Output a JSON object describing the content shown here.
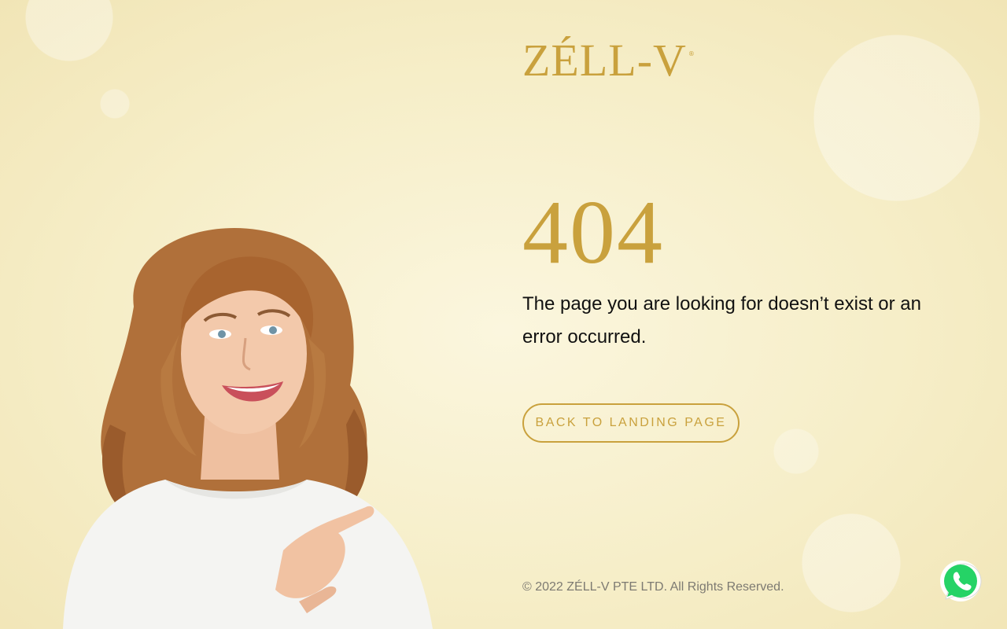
{
  "brand": {
    "logo_text": "ZÉLL-V",
    "logo_mark": "®",
    "accent_color": "#c9a13d"
  },
  "error": {
    "code": "404",
    "message": "The page you are looking for doesn’t exist or an error occurred."
  },
  "actions": {
    "back_label": "BACK TO LANDING PAGE"
  },
  "footer": {
    "copyright": "© 2022 ZÉLL-V PTE LTD. All Rights Reserved."
  },
  "floating": {
    "whatsapp_icon": "whatsapp-icon",
    "whatsapp_color": "#25d366"
  }
}
